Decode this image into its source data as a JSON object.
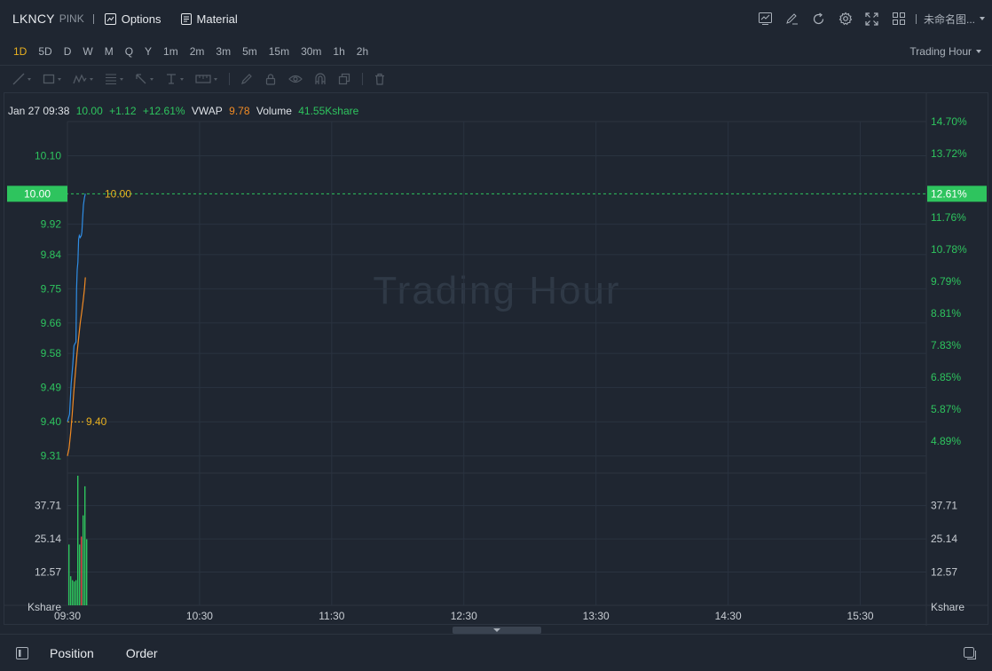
{
  "header": {
    "symbol": "LKNCY",
    "market": "PINK",
    "options_label": "Options",
    "material_label": "Material",
    "layout_name": "未命名图..."
  },
  "intervals": {
    "items": [
      "1D",
      "5D",
      "D",
      "W",
      "M",
      "Q",
      "Y",
      "1m",
      "2m",
      "3m",
      "5m",
      "15m",
      "30m",
      "1h",
      "2h"
    ],
    "active": "1D",
    "session_label": "Trading Hour"
  },
  "info": {
    "datetime": "Jan 27 09:38",
    "price": "10.00",
    "change": "+1.12",
    "change_pct": "+12.61%",
    "vwap_label": "VWAP",
    "vwap_value": "9.78",
    "volume_label": "Volume",
    "volume_value": "41.55Kshare"
  },
  "watermark": "Trading Hour",
  "colors": {
    "price_line": "#2f8de4",
    "vwap_line": "#f08a24",
    "up": "#2ec45e",
    "down": "#e04a4a",
    "marker": "#e8b01f",
    "accent": "#e8b01f"
  },
  "chart_data": {
    "type": "line",
    "price_axis": {
      "ticks": [
        "10.10",
        "9.92",
        "9.84",
        "9.75",
        "9.66",
        "9.58",
        "9.49",
        "9.40",
        "9.31"
      ],
      "tick_values": [
        10.1,
        9.92,
        9.84,
        9.75,
        9.66,
        9.58,
        9.49,
        9.4,
        9.31
      ],
      "range": [
        9.265,
        10.19
      ],
      "current_label": "10.00",
      "current_value": 10.0,
      "open_value": 9.4
    },
    "pct_axis": {
      "ticks": [
        "14.70%",
        "13.72%",
        "11.76%",
        "10.78%",
        "9.79%",
        "8.81%",
        "7.83%",
        "6.85%",
        "5.87%",
        "4.89%"
      ],
      "current_label": "12.61%"
    },
    "volume_axis": {
      "ticks": [
        "37.71",
        "25.14",
        "12.57"
      ],
      "tick_values": [
        37.71,
        25.14,
        12.57
      ],
      "unit": "Kshare",
      "max": 50
    },
    "time_axis": {
      "ticks": [
        "09:30",
        "10:30",
        "11:30",
        "12:30",
        "13:30",
        "14:30",
        "15:30"
      ],
      "tick_minutes": [
        0,
        60,
        120,
        180,
        240,
        300,
        360
      ],
      "session_minutes": 390
    },
    "markers": [
      {
        "label": "10.00",
        "value": 10.0
      },
      {
        "label": "9.40",
        "value": 9.4
      }
    ],
    "series": [
      {
        "name": "Price",
        "points": [
          [
            0.0,
            9.4
          ],
          [
            2.0,
            9.42
          ],
          [
            3.5,
            9.5
          ],
          [
            5.0,
            9.55
          ],
          [
            6.2,
            9.6
          ],
          [
            7.0,
            9.605
          ],
          [
            8.0,
            9.61
          ],
          [
            8.6,
            9.75
          ],
          [
            9.2,
            9.8
          ],
          [
            9.8,
            9.82
          ],
          [
            10.5,
            9.88
          ],
          [
            11.2,
            9.89
          ],
          [
            12.0,
            9.885
          ],
          [
            13.0,
            9.89
          ],
          [
            13.6,
            9.9
          ],
          [
            14.2,
            9.93
          ],
          [
            15.0,
            9.97
          ],
          [
            16.0,
            9.99
          ],
          [
            16.8,
            10.0
          ]
        ]
      },
      {
        "name": "VWAP",
        "points": [
          [
            0.0,
            9.31
          ],
          [
            1.5,
            9.33
          ],
          [
            3.0,
            9.37
          ],
          [
            4.5,
            9.42
          ],
          [
            6.0,
            9.48
          ],
          [
            7.5,
            9.53
          ],
          [
            9.0,
            9.58
          ],
          [
            10.5,
            9.62
          ],
          [
            12.0,
            9.66
          ],
          [
            13.5,
            9.69
          ],
          [
            14.8,
            9.72
          ],
          [
            16.0,
            9.75
          ],
          [
            16.8,
            9.78
          ]
        ]
      }
    ],
    "volume_bars": [
      {
        "t": 0.0,
        "v": 23.0,
        "up": true
      },
      {
        "t": 1.0,
        "v": 11.0,
        "up": true
      },
      {
        "t": 2.0,
        "v": 9.5,
        "up": true
      },
      {
        "t": 3.0,
        "v": 9.0,
        "up": true
      },
      {
        "t": 4.0,
        "v": 9.5,
        "up": true
      },
      {
        "t": 5.0,
        "v": 49.0,
        "up": true
      },
      {
        "t": 6.0,
        "v": 23.0,
        "up": true
      },
      {
        "t": 7.0,
        "v": 26.0,
        "up": false
      },
      {
        "t": 8.0,
        "v": 34.0,
        "up": true
      },
      {
        "t": 9.0,
        "v": 45.0,
        "up": true
      },
      {
        "t": 10.0,
        "v": 25.0,
        "up": true
      }
    ]
  },
  "bottom": {
    "position_label": "Position",
    "order_label": "Order"
  }
}
